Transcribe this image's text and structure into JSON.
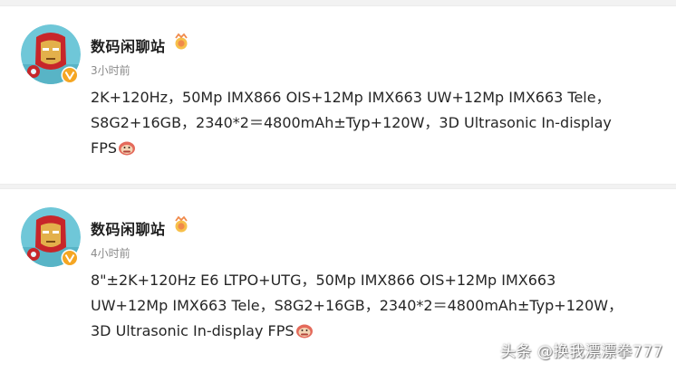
{
  "posts": [
    {
      "author": "数码闲聊站",
      "time": "3小时前",
      "lines": [
        "2K+120Hz，50Mp IMX866 OIS+12Mp IMX663 UW+12Mp IMX663 Tele，",
        "S8G2+16GB，2340*2＝4800mAh±Typ+120W，3D Ultrasonic In-display",
        "FPS"
      ]
    },
    {
      "author": "数码闲聊站",
      "time": "4小时前",
      "lines": [
        "8\"±2K+120Hz E6 LTPO+UTG，50Mp IMX866 OIS+12Mp IMX663",
        "UW+12Mp IMX663 Tele，S8G2+16GB，2340*2＝4800mAh±Typ+120W，",
        "3D Ultrasonic In-display FPS"
      ]
    }
  ],
  "watermark": "头条 @换我漂漂拳777",
  "colors": {
    "verified_badge": "#f5a623",
    "timestamp": "#8a8a8a",
    "separator": "#f2f2f2"
  },
  "icons": {
    "avatar": "iron-man-avatar",
    "verified": "verified-v-badge-icon",
    "medal": "fan-medal-icon",
    "emoji": "doge-emoji-icon"
  }
}
